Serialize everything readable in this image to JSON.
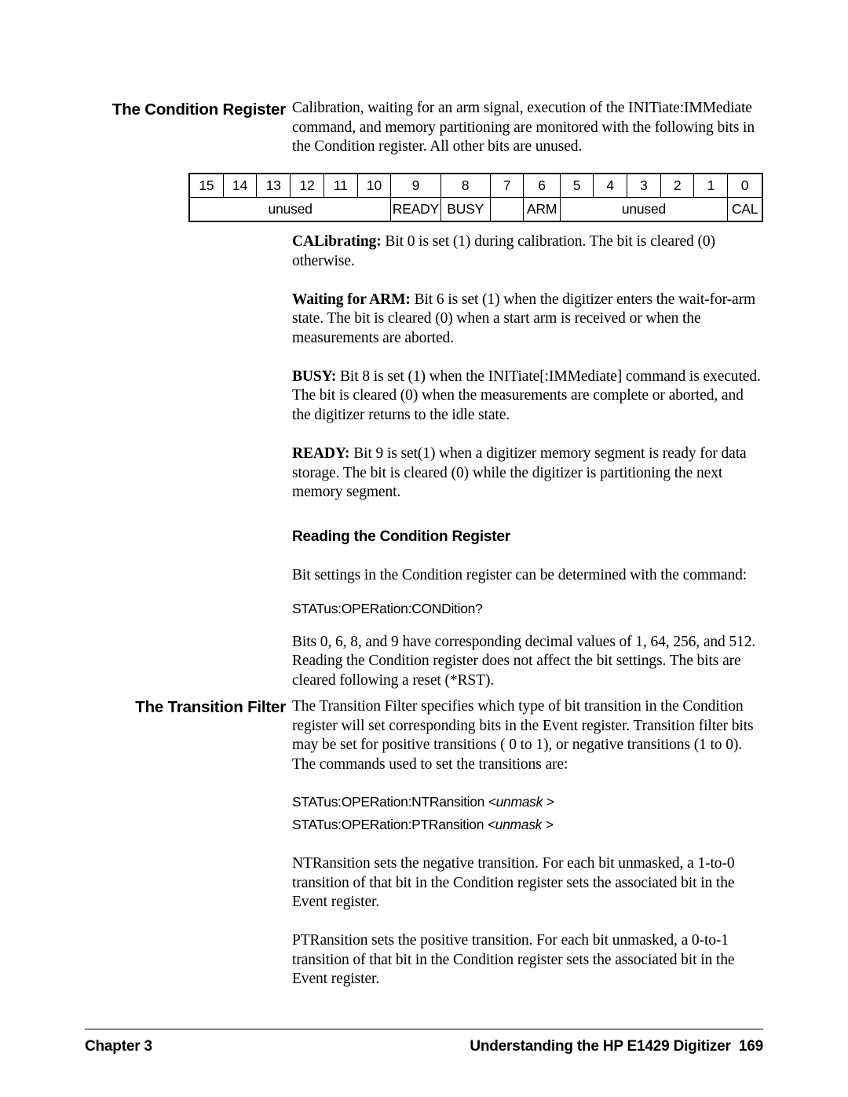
{
  "sections": {
    "condition_register": {
      "heading": "The Condition Register",
      "intro": "Calibration, waiting for an arm signal, execution of the INITiate:IMMediate command, and memory partitioning are monitored with the following bits in the Condition register. All other bits are unused."
    },
    "transition_filter": {
      "heading": "The Transition Filter",
      "intro": "The Transition Filter specifies which type of bit transition in the Condition register will set corresponding bits in the Event register. Transition filter bits may be set for positive transitions ( 0 to 1), or negative transitions (1 to 0). The commands used to set the transitions are:"
    }
  },
  "register_table": {
    "bit_numbers": [
      "15",
      "14",
      "13",
      "12",
      "11",
      "10",
      "9",
      "8",
      "7",
      "6",
      "5",
      "4",
      "3",
      "2",
      "1",
      "0"
    ],
    "labels": [
      {
        "text": "unused",
        "span": 6
      },
      {
        "text": "READY",
        "span": 1
      },
      {
        "text": "BUSY",
        "span": 1
      },
      {
        "text": "",
        "span": 1
      },
      {
        "text": "ARM",
        "span": 1
      },
      {
        "text": "unused",
        "span": 5
      },
      {
        "text": "CAL",
        "span": 1
      }
    ]
  },
  "bit_definitions": [
    {
      "lead": "CALibrating:",
      "text": " Bit 0 is set (1) during calibration. The bit is cleared (0) otherwise."
    },
    {
      "lead": "Waiting for ARM:",
      "text": " Bit 6 is set (1) when the digitizer enters the wait-for-arm state. The bit is cleared (0) when a start arm is received or when the measurements are aborted."
    },
    {
      "lead": "BUSY:",
      "text": " Bit 8 is set (1) when the INITiate[:IMMediate] command is executed. The bit is cleared (0) when the measurements are complete or aborted, and the digitizer returns to the idle state."
    },
    {
      "lead": "READY:",
      "text": " Bit 9 is set(1) when a digitizer memory segment is ready for data storage. The bit is cleared (0) while the digitizer is partitioning the next memory segment."
    }
  ],
  "reading_section": {
    "heading": "Reading the Condition Register",
    "paragraph1": "Bit settings in the Condition register can be determined with the command:",
    "command": "STATus:OPERation:CONDition?",
    "paragraph2": "Bits 0, 6, 8, and 9 have corresponding decimal values of 1, 64, 256, and 512. Reading the Condition register does not affect the bit settings. The bits are cleared following a reset (*RST)."
  },
  "transition_commands": [
    {
      "name": "STATus:OPERation:NTRansition ",
      "param": "<unmask >"
    },
    {
      "name": "STATus:OPERation:PTRansition ",
      "param": "<unmask >"
    }
  ],
  "transition_paragraphs": [
    "NTRansition sets the negative transition. For each bit unmasked, a 1-to-0 transition of that bit in the Condition register sets the associated bit in the Event register.",
    "PTRansition sets the positive transition. For each bit unmasked, a 0-to-1 transition of that bit in the Condition register sets the associated bit in the Event register."
  ],
  "footer": {
    "left": "Chapter 3",
    "right": "Understanding the HP E1429 Digitizer  169"
  }
}
